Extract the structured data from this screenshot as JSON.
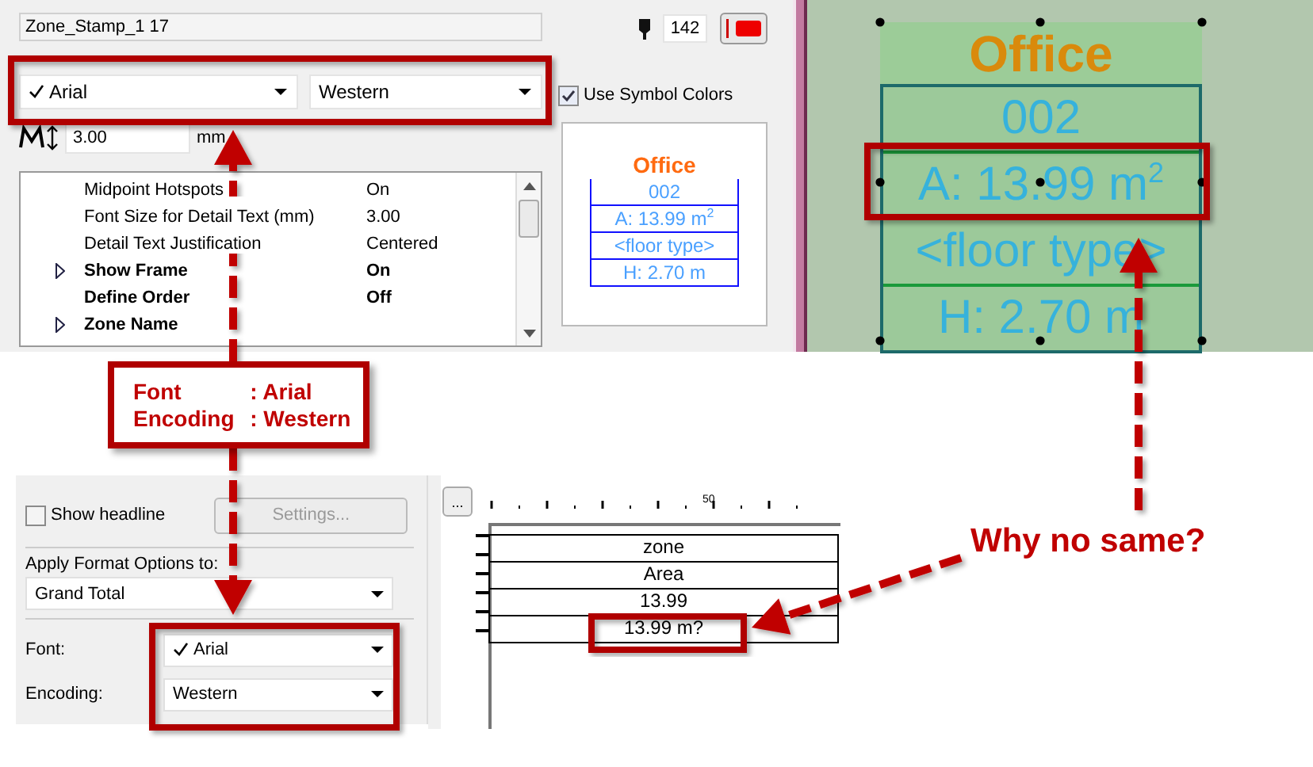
{
  "stamp_settings": {
    "name": "Zone_Stamp_1 17",
    "pen": "142",
    "font": {
      "value": "Arial",
      "checked": true
    },
    "encoding": "Western",
    "text_size": "3.00",
    "unit": "mm",
    "use_symbol_colors": {
      "label": "Use Symbol Colors",
      "checked": true
    },
    "preview": {
      "title": "Office",
      "rows": [
        "002",
        "A: 13.99 m$^{2}$",
        "<floor type>",
        "H: 2.70 m"
      ]
    },
    "properties": [
      {
        "kind": "item",
        "label": "Midpoint Hotspots",
        "value": "On",
        "expandable": false
      },
      {
        "kind": "item",
        "label": "Font Size for Detail Text (mm)",
        "value": "3.00",
        "expandable": false
      },
      {
        "kind": "item",
        "label": "Detail Text Justification",
        "value": "Centered",
        "expandable": false
      },
      {
        "kind": "group",
        "label": "Show Frame",
        "value": "On",
        "expandable": true
      },
      {
        "kind": "group",
        "label": "Define Order",
        "value": "Off",
        "expandable": false
      },
      {
        "kind": "group",
        "label": "Zone Name",
        "expandable": true
      }
    ]
  },
  "plan_view": {
    "title": "Office",
    "rows": [
      "002",
      "A: 13.99 m$^{2}$",
      "<floor type>",
      "H: 2.70 m"
    ]
  },
  "report_settings": {
    "show_headline": {
      "label": "Show headline",
      "checked": false
    },
    "settings_button": {
      "label": "Settings...",
      "disabled": true
    },
    "apply_label": "Apply Format Options to:",
    "apply_value": "Grand Total",
    "font_label": "Font:",
    "font": {
      "value": "Arial",
      "checked": true
    },
    "encoding_label": "Encoding:",
    "encoding": "Western"
  },
  "report_preview": {
    "more_button": "...",
    "ruler_label": "50",
    "rows": [
      "zone",
      "Area",
      "13.99",
      "13.99 m?"
    ]
  },
  "annotations": {
    "callout": [
      {
        "label": "Font",
        "value": ": Arial"
      },
      {
        "label": "Encoding",
        "value": ": Western"
      }
    ],
    "question": "Why no same?"
  }
}
